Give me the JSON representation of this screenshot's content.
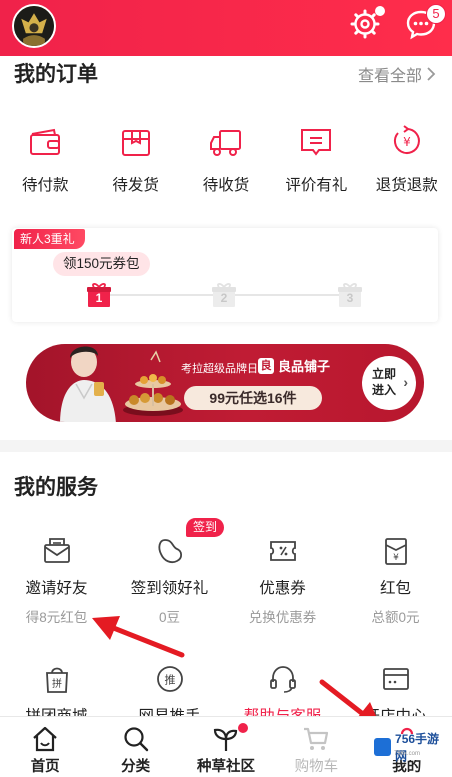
{
  "header": {
    "message_count": "5",
    "accent": "#f0224a"
  },
  "orders": {
    "title": "我的订单",
    "view_all": "查看全部",
    "items": [
      {
        "label": "待付款",
        "icon": "wallet-icon"
      },
      {
        "label": "待发货",
        "icon": "package-icon"
      },
      {
        "label": "待收货",
        "icon": "truck-icon"
      },
      {
        "label": "评价有礼",
        "icon": "comment-icon"
      },
      {
        "label": "退货退款",
        "icon": "refund-icon"
      }
    ]
  },
  "new_user": {
    "tag": "新人3重礼",
    "bubble": "领150元券包",
    "steps": [
      "1",
      "2",
      "3"
    ]
  },
  "banner": {
    "tagline": "考拉超级品牌日",
    "brand": "良品铺子",
    "brand_logo": "良",
    "offer": "99元任选16件",
    "cta_line1": "立即",
    "cta_line2": "进入"
  },
  "services": {
    "title": "我的服务",
    "sign_badge": "签到",
    "items": [
      {
        "name": "邀请好友",
        "sub": "得8元红包",
        "icon": "invite-envelope-icon"
      },
      {
        "name": "签到领好礼",
        "sub": "0豆",
        "icon": "bean-icon"
      },
      {
        "name": "优惠券",
        "sub": "兑换优惠券",
        "icon": "coupon-icon"
      },
      {
        "name": "红包",
        "sub": "总额0元",
        "icon": "red-packet-icon"
      }
    ],
    "items2": [
      {
        "name": "拼团商城",
        "icon": "group-buy-icon"
      },
      {
        "name": "网易推手",
        "icon": "promote-icon"
      },
      {
        "name": "帮助与客服",
        "icon": "headset-icon"
      },
      {
        "name": "开店中心",
        "icon": "store-card-icon"
      }
    ]
  },
  "tabbar": {
    "tabs": [
      {
        "label": "首页",
        "icon": "home-icon"
      },
      {
        "label": "分类",
        "icon": "search-icon"
      },
      {
        "label": "种草社区",
        "icon": "sprout-icon"
      },
      {
        "label": "购物车",
        "icon": "cart-icon"
      },
      {
        "label": "我的",
        "icon": "user-icon"
      }
    ]
  },
  "watermark": {
    "text": "756手游网",
    "sub": "756x.com"
  }
}
